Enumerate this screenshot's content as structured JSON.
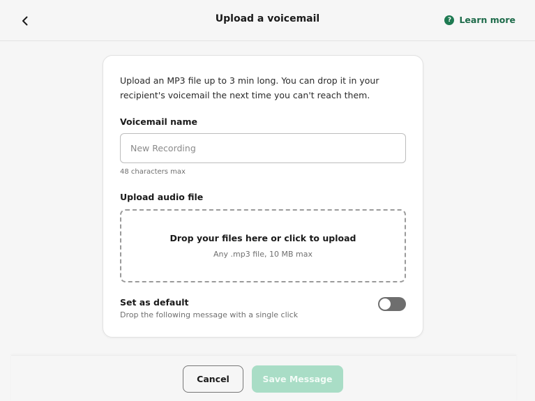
{
  "header": {
    "back_icon": "chevron-left-icon",
    "title": "Upload a voicemail",
    "learn_more_label": "Learn more",
    "help_icon": "question-circle-icon",
    "help_glyph": "?"
  },
  "card": {
    "intro": "Upload an MP3 file up to 3 min long. You can drop it in your recipient's voicemail the next time you can't reach them.",
    "name_label": "Voicemail name",
    "name_placeholder": "New Recording",
    "name_value": "",
    "name_hint": "48 characters max",
    "upload_label": "Upload audio file",
    "drop_main": "Drop your files here or click to upload",
    "drop_sub": "Any .mp3 file, 10 MB max",
    "default_title": "Set as default",
    "default_sub": "Drop the following message with a single click",
    "default_on": false
  },
  "footer": {
    "cancel_label": "Cancel",
    "save_label": "Save Message"
  },
  "colors": {
    "accent": "#1e7a52",
    "save_disabled": "#a9ddc6",
    "toggle_off": "#6e6e6e"
  }
}
